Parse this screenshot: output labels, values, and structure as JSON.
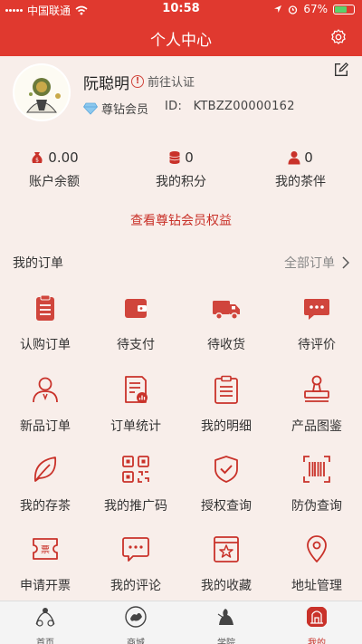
{
  "status": {
    "carrier": "中国联通",
    "time": "10:58",
    "battery": "67%",
    "battery_level": 0.67
  },
  "nav": {
    "title": "个人中心",
    "settings_icon": "gear-icon"
  },
  "profile": {
    "name": "阮聪明",
    "verify_label": "前往认证",
    "member_label": "尊钻会员",
    "id_label": "ID:",
    "id_value": "KTBZZ00000162"
  },
  "stats": [
    {
      "value": "0.00",
      "label": "账户余额",
      "icon": "money-bag-icon"
    },
    {
      "value": "0",
      "label": "我的积分",
      "icon": "coins-icon"
    },
    {
      "value": "0",
      "label": "我的茶伴",
      "icon": "person-icon"
    }
  ],
  "vip_link": "查看尊钻会员权益",
  "orders": {
    "title": "我的订单",
    "all_label": "全部订单"
  },
  "grid": [
    {
      "label": "认购订单",
      "icon": "clipboard-icon"
    },
    {
      "label": "待支付",
      "icon": "wallet-icon"
    },
    {
      "label": "待收货",
      "icon": "truck-icon"
    },
    {
      "label": "待评价",
      "icon": "chat-icon"
    },
    {
      "label": "新品订单",
      "icon": "user-icon"
    },
    {
      "label": "订单统计",
      "icon": "report-icon"
    },
    {
      "label": "我的明细",
      "icon": "details-icon"
    },
    {
      "label": "产品图鉴",
      "icon": "stamp-icon"
    },
    {
      "label": "我的存茶",
      "icon": "leaf-icon"
    },
    {
      "label": "我的推广码",
      "icon": "qrcode-icon"
    },
    {
      "label": "授权查询",
      "icon": "shield-check-icon"
    },
    {
      "label": "防伪查询",
      "icon": "barcode-icon"
    },
    {
      "label": "申请开票",
      "icon": "invoice-icon"
    },
    {
      "label": "我的评论",
      "icon": "comment-icon"
    },
    {
      "label": "我的收藏",
      "icon": "bookmark-star-icon"
    },
    {
      "label": "地址管理",
      "icon": "location-icon"
    }
  ],
  "tabs": [
    {
      "label": "首页",
      "icon": "home-icon"
    },
    {
      "label": "商城",
      "icon": "mall-icon"
    },
    {
      "label": "学院",
      "icon": "academy-icon"
    },
    {
      "label": "我的",
      "icon": "mine-icon"
    }
  ],
  "colors": {
    "brand_red": "#e0392f",
    "accent": "#c9322a",
    "background": "#f8eeea"
  }
}
